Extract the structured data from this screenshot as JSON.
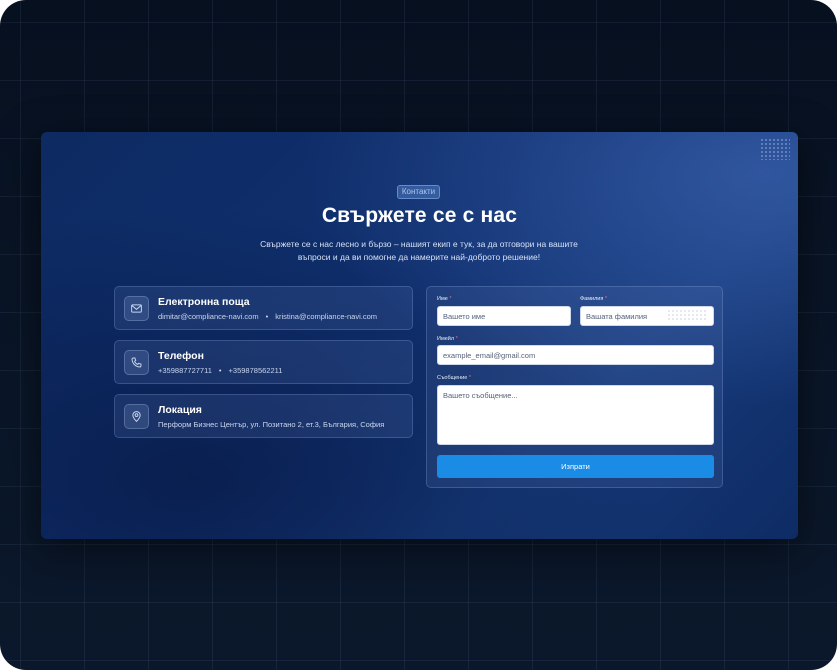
{
  "section": {
    "badge": "Контакти",
    "title": "Свържете се с нас",
    "subtitle": "Свържете се с нас лесно и бързо – нашият екип е тук, за да отговори на вашите въпроси и да ви помогне да намерите най-доброто решение!"
  },
  "contacts": {
    "email": {
      "title": "Електронна поща",
      "value_1": "dimitar@compliance-navi.com",
      "separator": "•",
      "value_2": "kristina@compliance-navi.com",
      "icon": "mail-icon"
    },
    "phone": {
      "title": "Телефон",
      "value_1": "+359887727711",
      "separator": "•",
      "value_2": "+359878562211",
      "icon": "phone-icon"
    },
    "location": {
      "title": "Локация",
      "value": "Перформ Бизнес Център, ул. Позитано 2, ет.3, България, София",
      "icon": "location-pin-icon"
    }
  },
  "form": {
    "first_name": {
      "label": "Име",
      "required": "*",
      "placeholder": "Вашето име"
    },
    "last_name": {
      "label": "Фамилия",
      "required": "*",
      "placeholder": "Вашата фамилия"
    },
    "email": {
      "label": "Имейл",
      "required": "*",
      "placeholder": "example_email@gmail.com"
    },
    "message": {
      "label": "Съобщение",
      "required": "*",
      "placeholder": "Вашето съобщение..."
    },
    "submit_label": "Изпрати"
  },
  "colors": {
    "accent": "#1a8ce6",
    "card_background": "#10306f",
    "page_background": "#07101f"
  }
}
